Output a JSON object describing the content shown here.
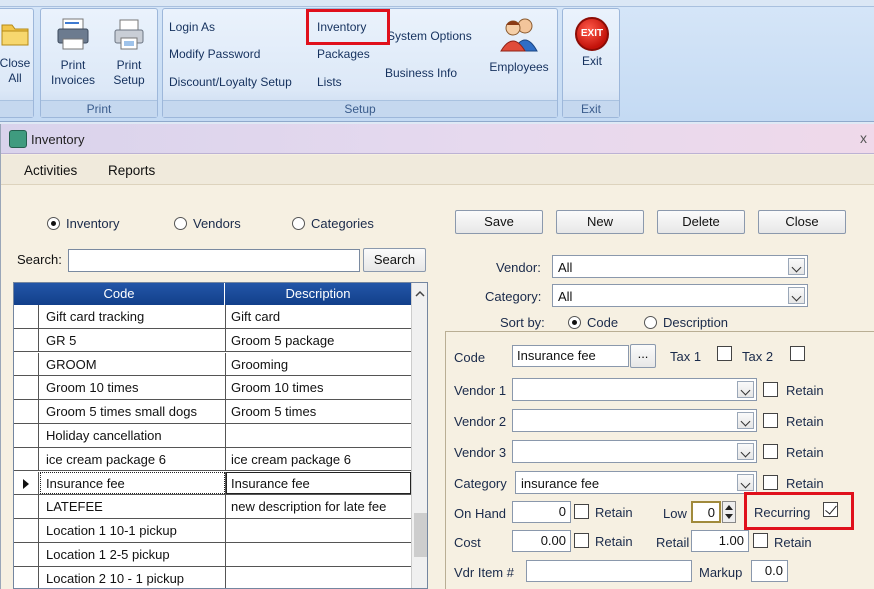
{
  "ribbon": {
    "close_all": [
      "Close",
      "All"
    ],
    "print_invoices": [
      "Print",
      "Invoices"
    ],
    "print_setup": [
      "Print",
      "Setup"
    ],
    "print_group": "Print",
    "setup_links": {
      "login_as": "Login As",
      "modify_password": "Modify Password",
      "discount_setup": "Discount/Loyalty Setup",
      "inventory": "Inventory",
      "packages": "Packages",
      "lists": "Lists",
      "system_options": "System Options",
      "business_info": "Business Info",
      "employees": "Employees"
    },
    "setup_group": "Setup",
    "exit_label": "Exit",
    "exit_icon_text": "EXIT",
    "exit_group": "Exit"
  },
  "window": {
    "title": "Inventory",
    "close": "x"
  },
  "menu": {
    "activities": "Activities",
    "reports": "Reports"
  },
  "filter": {
    "inventory": "Inventory",
    "vendors": "Vendors",
    "categories": "Categories",
    "selected": "Inventory"
  },
  "search": {
    "label": "Search:",
    "value": "",
    "button": "Search"
  },
  "grid": {
    "columns": [
      "Code",
      "Description"
    ],
    "rows": [
      {
        "code": "Gift card tracking",
        "description": "Gift card"
      },
      {
        "code": "GR 5",
        "description": "Groom 5 package"
      },
      {
        "code": "GROOM",
        "description": "Grooming"
      },
      {
        "code": "Groom 10 times",
        "description": "Groom 10 times"
      },
      {
        "code": "Groom 5 times small dogs",
        "description": "Groom 5 times"
      },
      {
        "code": "Holiday cancellation",
        "description": ""
      },
      {
        "code": "ice cream package 6",
        "description": "ice cream package 6"
      },
      {
        "code": "Insurance fee",
        "description": "Insurance fee"
      },
      {
        "code": "LATEFEE",
        "description": "new description for late fee"
      },
      {
        "code": "Location 1 10-1 pickup",
        "description": ""
      },
      {
        "code": "Location 1 2-5 pickup",
        "description": ""
      },
      {
        "code": "Location 2 10 - 1 pickup",
        "description": ""
      }
    ],
    "current_row": 7
  },
  "actions": {
    "save": "Save",
    "new": "New",
    "delete": "Delete",
    "close": "Close"
  },
  "filters": {
    "vendor_label": "Vendor:",
    "vendor_value": "All",
    "category_label": "Category:",
    "category_value": "All",
    "sort_label": "Sort by:",
    "sort_code": "Code",
    "sort_description": "Description",
    "sort_selected": "Code"
  },
  "details": {
    "code_label": "Code",
    "code_value": "Insurance fee",
    "browse": "...",
    "tax1": "Tax 1",
    "tax2": "Tax 2",
    "vendor1": "Vendor 1",
    "vendor2": "Vendor 2",
    "vendor3": "Vendor 3",
    "category_label": "Category",
    "category_value": "insurance fee",
    "retain": "Retain",
    "on_hand_label": "On Hand",
    "on_hand_value": "0",
    "low_label": "Low",
    "low_value": "0",
    "recurring_label": "Recurring",
    "recurring_checked": true,
    "cost_label": "Cost",
    "cost_value": "0.00",
    "retail_label": "Retail",
    "retail_value": "1.00",
    "vdr_item_label": "Vdr Item #",
    "vdr_item_value": "",
    "markup_label": "Markup",
    "markup_value": "0.0"
  },
  "colors": {
    "highlight": "#e0101c",
    "grid_header": "#1a4a99",
    "window_bg": "#f6f0e2"
  }
}
